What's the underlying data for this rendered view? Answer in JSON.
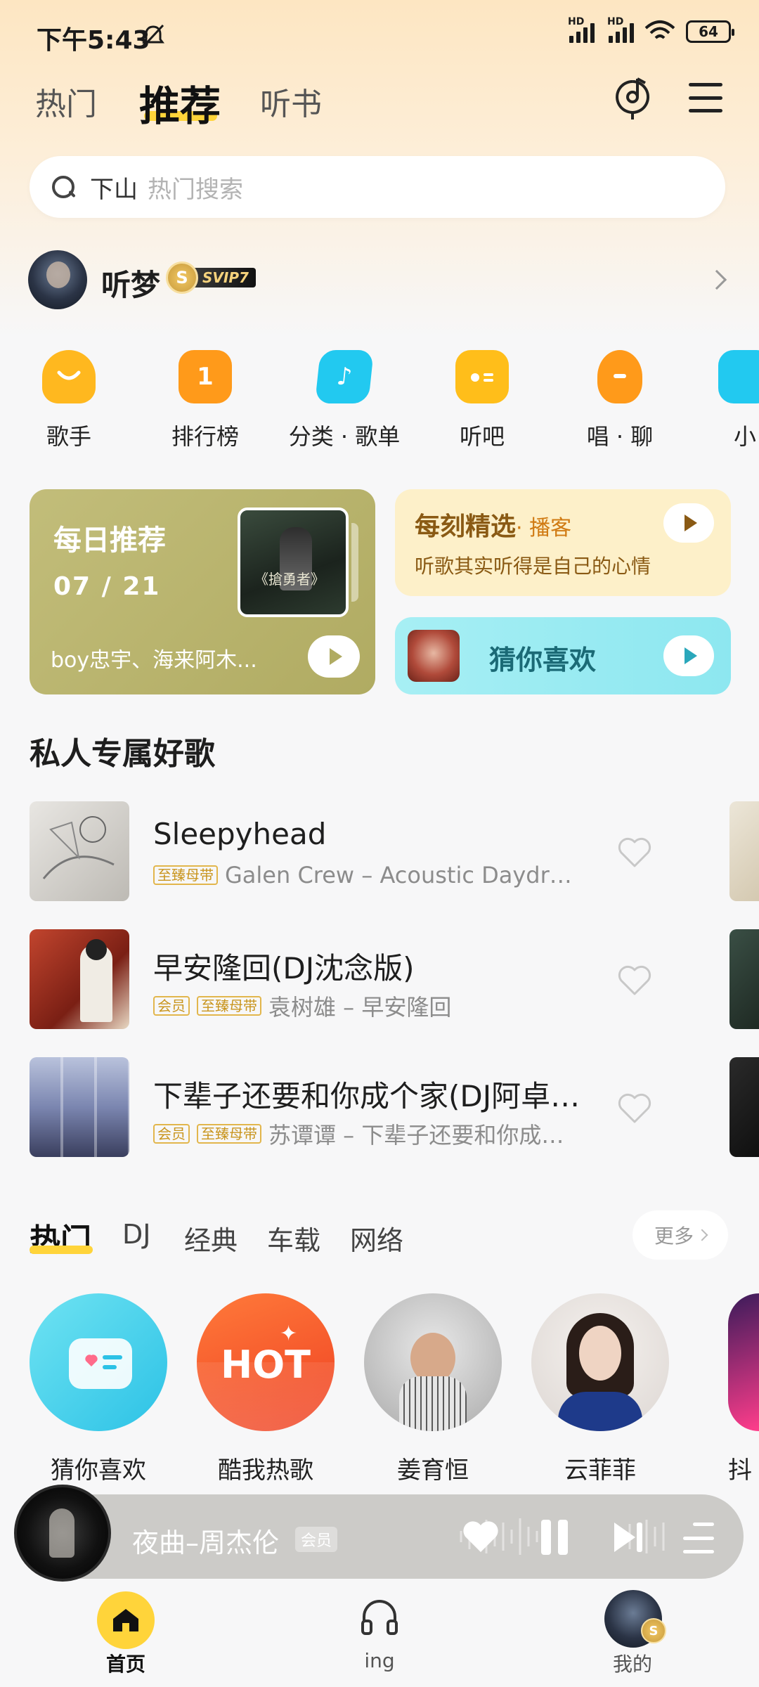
{
  "status": {
    "time": "下午5:43",
    "battery": "64",
    "hd": "HD"
  },
  "top_tabs": [
    "热门",
    "推荐",
    "听书"
  ],
  "search": {
    "value": "下山",
    "placeholder": "热门搜索"
  },
  "profile": {
    "name": "听梦",
    "vip_level": "SVIP7",
    "vip_letter": "S"
  },
  "categories": [
    {
      "label": "歌手",
      "color": "#ffb81f",
      "icon": "singer-icon"
    },
    {
      "label": "排行榜",
      "color": "#ff9a1a",
      "icon": "chart-icon",
      "glyph": "1"
    },
    {
      "label": "分类 · 歌单",
      "color": "#22c9f0",
      "icon": "note-icon",
      "glyph": "♪"
    },
    {
      "label": "听吧",
      "color": "#ffbe1a",
      "icon": "radio-icon"
    },
    {
      "label": "唱 · 聊",
      "color": "#ff9a1a",
      "icon": "mic-icon"
    },
    {
      "label": "小",
      "color": "#22c9f0",
      "icon": "chat-icon"
    }
  ],
  "daily": {
    "title": "每日推荐",
    "date": "07 / 21",
    "artists": "boy忠宇、海来阿木...",
    "cover_text": "《搶勇者》"
  },
  "podcast": {
    "title": "每刻精选",
    "tag": "· 播客",
    "subtitle": "听歌其实听得是自己的心情"
  },
  "guess": {
    "title": "猜你喜欢"
  },
  "private_section": {
    "title": "私人专属好歌",
    "songs": [
      {
        "title": "Sleepyhead",
        "tags": [
          "至臻母带"
        ],
        "meta": "Galen Crew – Acoustic Daydr…"
      },
      {
        "title": "早安隆回(DJ沈念版)",
        "tags": [
          "会员",
          "至臻母带"
        ],
        "meta": "袁树雄 – 早安隆回"
      },
      {
        "title": "下辈子还要和你成个家(DJ阿卓…",
        "tags": [
          "会员",
          "至臻母带"
        ],
        "meta": "苏谭谭 – 下辈子还要和你成…"
      }
    ]
  },
  "hot_tabs": [
    "热门",
    "DJ",
    "经典",
    "车载",
    "网络"
  ],
  "more_label": "更多",
  "circles": [
    {
      "label": "猜你喜欢"
    },
    {
      "label": "酷我热歌",
      "text": "HOT"
    },
    {
      "label": "姜育恒"
    },
    {
      "label": "云菲菲"
    },
    {
      "label": "抖"
    }
  ],
  "player": {
    "title": "夜曲–周杰伦",
    "tag": "会员"
  },
  "nav": [
    "首页",
    "ing",
    "我的"
  ],
  "colors": {
    "accent": "#ffd43a",
    "vip_gold": "#e2b64c"
  }
}
